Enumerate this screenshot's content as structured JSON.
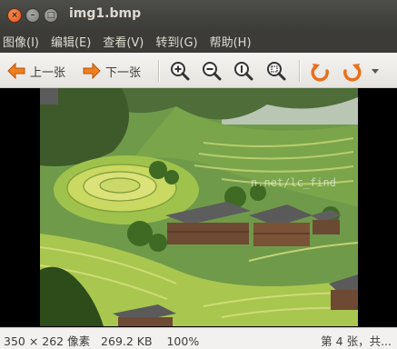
{
  "window": {
    "title": "img1.bmp",
    "close_glyph": "×",
    "minimize_glyph": "–",
    "maximize_glyph": "□"
  },
  "menu": [
    "图像(I)",
    "编辑(E)",
    "查看(V)",
    "转到(G)",
    "帮助(H)"
  ],
  "toolbar": {
    "prev_label": "上一张",
    "next_label": "下一张",
    "icons": [
      "left-arrow-icon",
      "right-arrow-icon",
      "zoom-in-icon",
      "zoom-out-icon",
      "zoom-normal-icon",
      "zoom-fit-icon",
      "rotate-left-icon",
      "rotate-right-icon",
      "overflow-arrow-icon"
    ],
    "accent": "#e8701a"
  },
  "image": {
    "subject": "terraced-rice-fields",
    "watermark": "n.net/lc_find"
  },
  "status": {
    "dimensions": "350 × 262 像素",
    "size": "269.2 KB",
    "zoom": "100%",
    "position": "第 4 张，共..."
  }
}
